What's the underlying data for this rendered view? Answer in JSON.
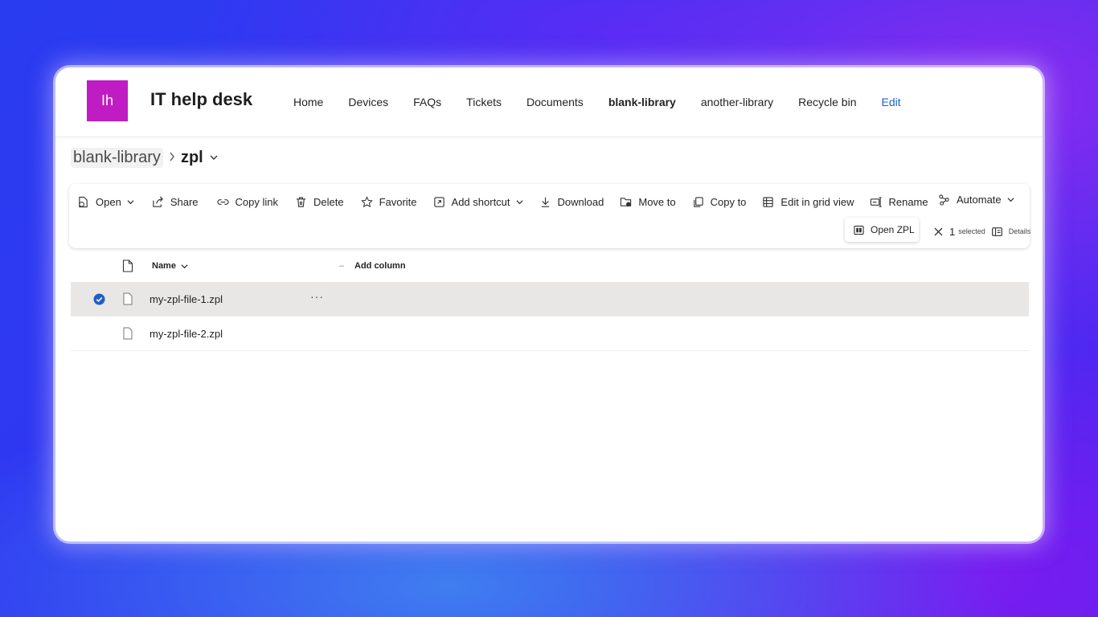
{
  "site": {
    "logo_initials": "Ih",
    "logo_color": "#c01cc3",
    "title": "IT help desk",
    "nav": [
      {
        "label": "Home"
      },
      {
        "label": "Devices"
      },
      {
        "label": "FAQs"
      },
      {
        "label": "Tickets"
      },
      {
        "label": "Documents"
      },
      {
        "label": "blank-library",
        "active": true
      },
      {
        "label": "another-library"
      },
      {
        "label": "Recycle bin"
      },
      {
        "label": "Edit"
      }
    ]
  },
  "breadcrumb": {
    "parent": "blank-library",
    "separator": ">",
    "current": "zpl"
  },
  "commands": {
    "open": "Open",
    "share": "Share",
    "copy_link": "Copy link",
    "delete": "Delete",
    "favorite": "Favorite",
    "add_shortcut": "Add shortcut",
    "download": "Download",
    "move_to": "Move to",
    "copy_to": "Copy to",
    "edit_grid": "Edit in grid view",
    "rename": "Rename",
    "automate": "Automate",
    "open_zpl": "Open ZPL"
  },
  "selection": {
    "count": "1",
    "label": "selected",
    "details": "Details"
  },
  "list": {
    "column_name": "Name",
    "add_column_dash": "–",
    "add_column": "Add column",
    "rows": [
      {
        "name": "my-zpl-file-1.zpl",
        "selected": true,
        "more": "···"
      },
      {
        "name": "my-zpl-file-2.zpl",
        "selected": false
      }
    ]
  },
  "colors": {
    "accent_blue": "#1f5fc9",
    "selected_row": "#e9e7e6"
  }
}
